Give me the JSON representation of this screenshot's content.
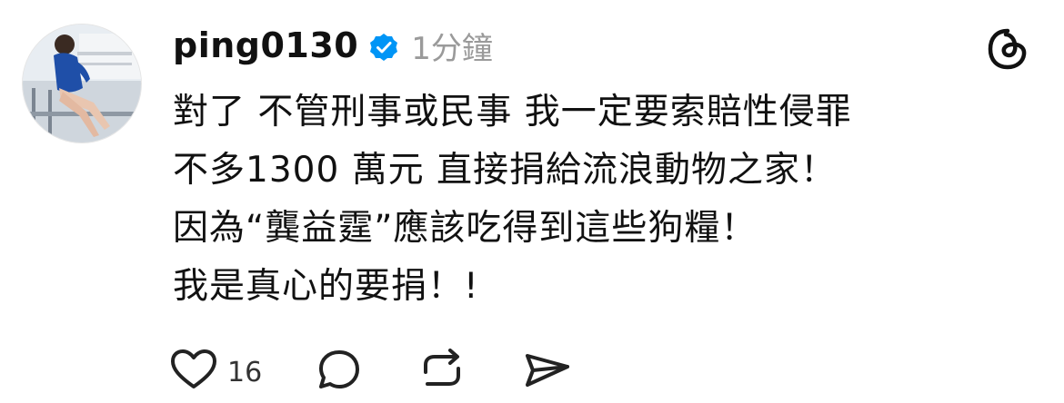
{
  "post": {
    "username": "ping0130",
    "time": "1分鐘",
    "verified_icon": "verified-badge-icon",
    "lines": [
      "對了 不管刑事或民事 我一定要索賠性侵罪",
      "不多1300 萬元 直接捐給流浪動物之家！",
      "因為“龔益霆”應該吃得到這些狗糧！",
      "我是真心的要捐！!"
    ],
    "actions": {
      "like_count": "16",
      "like_icon": "heart-icon",
      "comment_icon": "comment-icon",
      "repost_icon": "repost-icon",
      "share_icon": "send-icon"
    }
  },
  "app": {
    "logo_icon": "threads-logo-icon"
  },
  "colors": {
    "verified_blue": "#0095f6",
    "text": "#111111",
    "muted": "#9a9a9a"
  }
}
